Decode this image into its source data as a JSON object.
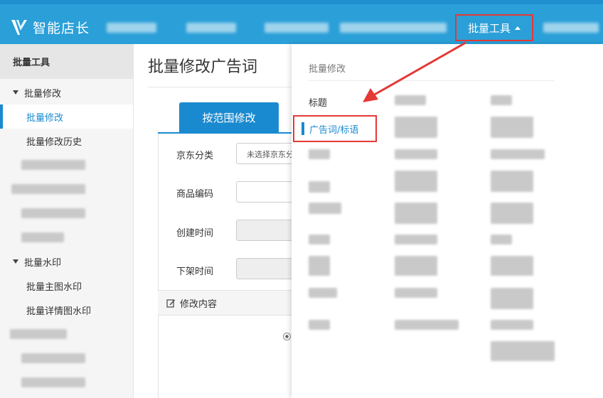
{
  "header": {
    "brand": "智能店长",
    "nav_active": "批量工具"
  },
  "sidebar": {
    "title": "批量工具",
    "group1": "批量修改",
    "group1_items": [
      "批量修改",
      "批量修改历史"
    ],
    "group2": "批量水印",
    "group2_items": [
      "批量主图水印",
      "批量详情图水印"
    ]
  },
  "main": {
    "page_title": "批量修改广告词",
    "tab_label": "按范围修改",
    "form": {
      "category_label": "京东分类",
      "category_value": "未选择京东分",
      "sku_label": "商品编码",
      "created_label": "创建时间",
      "offshelf_label": "下架时间",
      "edit_content_label": "修改内容"
    }
  },
  "dropdown": {
    "section_title": "批量修改",
    "items": [
      "标题",
      "广告词/标语"
    ]
  },
  "colors": {
    "topbar": "#2a9fd8",
    "accent": "#1a8ad0",
    "annotation": "#e53935"
  }
}
